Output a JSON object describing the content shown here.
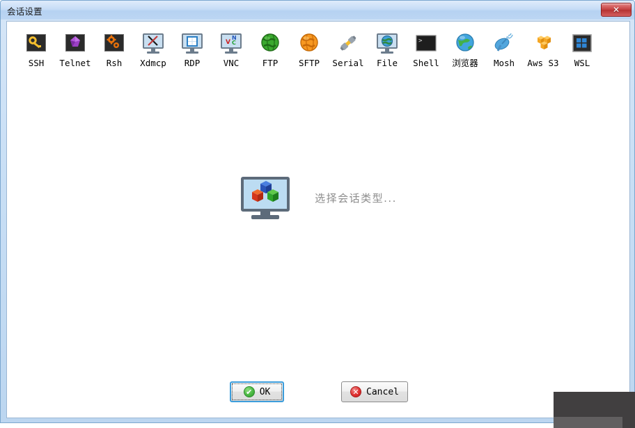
{
  "window": {
    "title": "会话设置",
    "close_label": "✕",
    "close_icon": "close-icon"
  },
  "toolbar": {
    "items": [
      {
        "label": "SSH",
        "icon": "key-icon"
      },
      {
        "label": "Telnet",
        "icon": "gem-icon"
      },
      {
        "label": "Rsh",
        "icon": "gears-icon"
      },
      {
        "label": "Xdmcp",
        "icon": "monitor-x-icon"
      },
      {
        "label": "RDP",
        "icon": "monitor-windows-icon"
      },
      {
        "label": "VNC",
        "icon": "monitor-vnc-icon"
      },
      {
        "label": "FTP",
        "icon": "green-globe-icon"
      },
      {
        "label": "SFTP",
        "icon": "orange-globe-icon"
      },
      {
        "label": "Serial",
        "icon": "plug-connector-icon"
      },
      {
        "label": "File",
        "icon": "monitor-globe-icon"
      },
      {
        "label": "Shell",
        "icon": "terminal-icon"
      },
      {
        "label": "浏览器",
        "icon": "blue-globe-icon",
        "cjk": true
      },
      {
        "label": "Mosh",
        "icon": "satellite-dish-icon"
      },
      {
        "label": "Aws S3",
        "icon": "aws-cubes-icon"
      },
      {
        "label": "WSL",
        "icon": "windows-tile-icon"
      }
    ]
  },
  "main": {
    "placeholder_text": "选择会话类型...",
    "placeholder_icon": "monitor-cubes-icon"
  },
  "footer": {
    "ok_label": "OK",
    "ok_icon": "check-circle-icon",
    "ok_glyph": "✔",
    "cancel_label": "Cancel",
    "cancel_icon": "x-circle-icon",
    "cancel_glyph": "✕"
  },
  "colors": {
    "title_bar": "#bcd6f3",
    "accent_focus": "#3c9ddb",
    "ok_green": "#4cb944",
    "cancel_red": "#e03030",
    "overlay_dark": "#413f40",
    "placeholder_gray": "#8d8d8d"
  }
}
